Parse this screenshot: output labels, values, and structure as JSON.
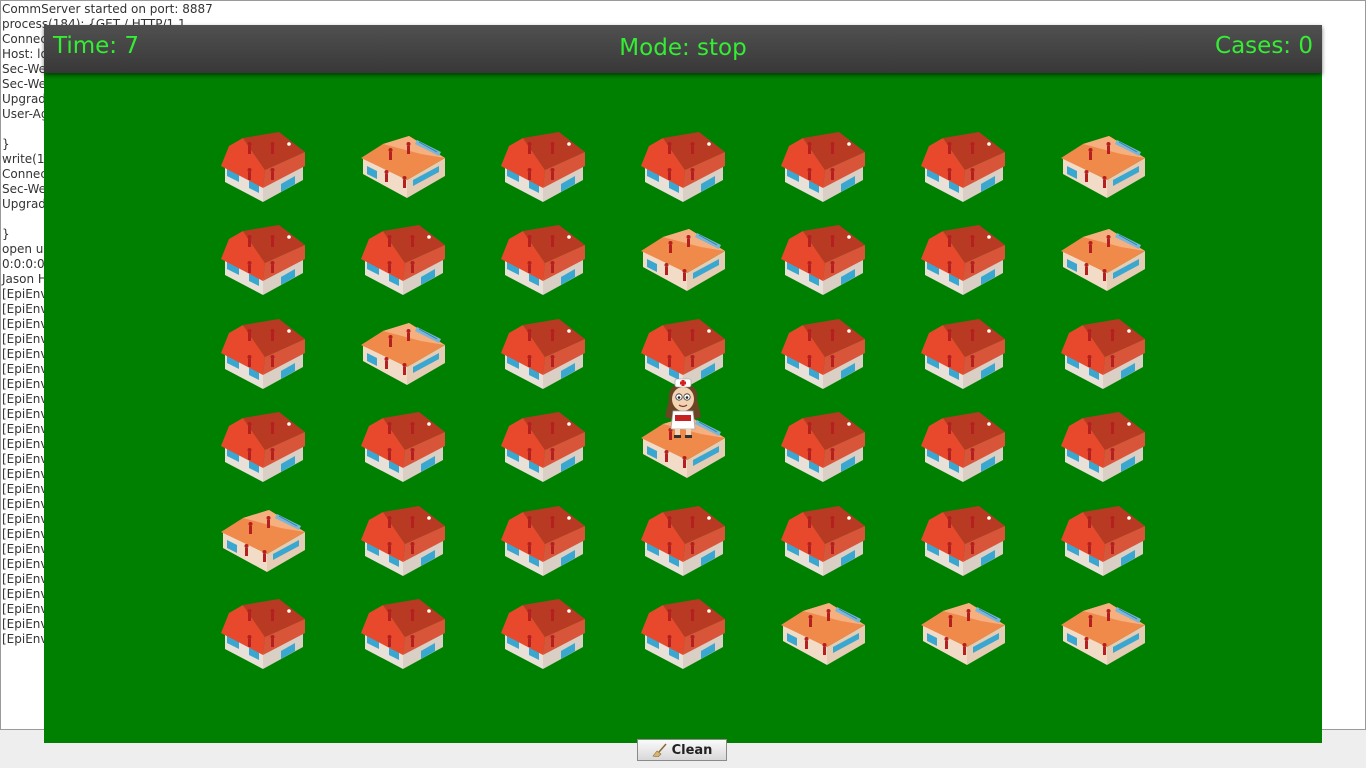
{
  "console": {
    "lines": [
      "CommServer started on port: 8887",
      "process(184): {GET / HTTP/1.1",
      "Connec",
      "Host: lo",
      "Sec-We",
      "Sec-We",
      "Upgrad",
      "User-Ag",
      "",
      "}",
      "write(1",
      "Connec",
      "Sec-We",
      "Upgrad",
      "",
      "}",
      "open u",
      "0:0:0:0",
      "Jason H",
      "[EpiEnv",
      "[EpiEnv",
      "[EpiEnv",
      "[EpiEnv",
      "[EpiEnv",
      "[EpiEnv",
      "[EpiEnv",
      "[EpiEnv",
      "[EpiEnv",
      "[EpiEnv",
      "[EpiEnv",
      "[EpiEnv",
      "[EpiEnv",
      "[EpiEnv",
      "[EpiEnv",
      "[EpiEnv",
      "[EpiEnv",
      "[EpiEnv",
      "[EpiEnv",
      "[EpiEnv",
      "[EpiEnv",
      "[EpiEnv",
      "[EpiEnv",
      "[EpiEnv"
    ]
  },
  "hud": {
    "time": "Time: 7",
    "mode": "Mode: stop",
    "cases": "Cases: 0"
  },
  "map": {
    "legend_types": [
      "house",
      "hospital"
    ],
    "grid": [
      [
        "house",
        "hospital",
        "house",
        "house",
        "house",
        "house",
        "hospital"
      ],
      [
        "house",
        "house",
        "house",
        "hospital",
        "house",
        "house",
        "hospital"
      ],
      [
        "house",
        "hospital",
        "house",
        "house",
        "house",
        "house",
        "house"
      ],
      [
        "house",
        "house",
        "house",
        "hospital",
        "house",
        "house",
        "house"
      ],
      [
        "hospital",
        "house",
        "house",
        "house",
        "house",
        "house",
        "house"
      ],
      [
        "house",
        "house",
        "house",
        "house",
        "hospital",
        "hospital",
        "hospital"
      ]
    ],
    "agent": {
      "type": "nurse",
      "row": 3,
      "col": 3
    }
  },
  "colors": {
    "field": "#008000",
    "hud_text": "#33ee33",
    "hud_bar": "#3f3f3f",
    "roof": "#e8492c",
    "roof_dark": "#b93a22",
    "hospital_roof": "#f08a4a",
    "wall": "#f3dcc7",
    "window": "#3aa7d0",
    "person": "#b41f1f"
  },
  "footer": {
    "clean_label": "Clean",
    "clean_icon": "broom-icon"
  }
}
